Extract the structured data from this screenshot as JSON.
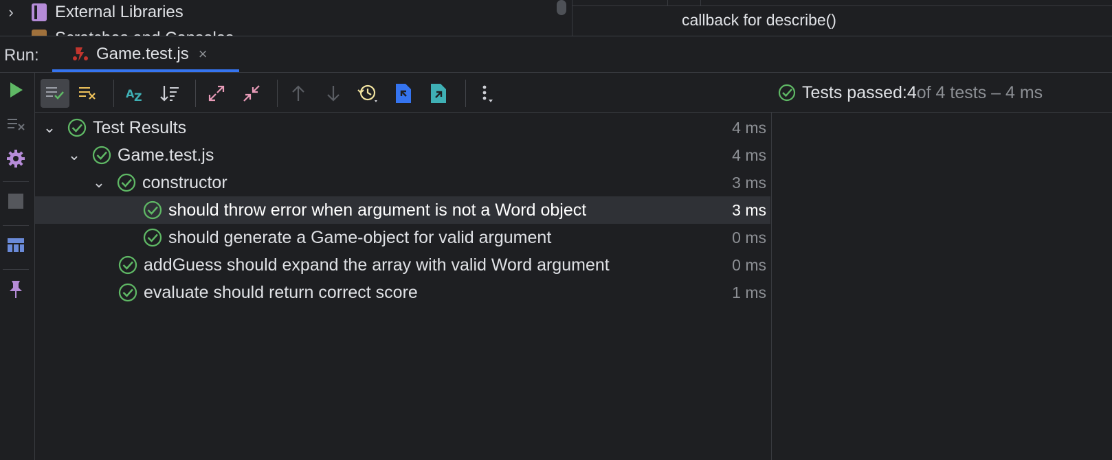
{
  "project_tree": {
    "items": [
      {
        "label": "External Libraries",
        "icon": "library-icon"
      },
      {
        "label": "Scratches and Consoles",
        "icon": "scratches-icon"
      }
    ]
  },
  "editor": {
    "breadcrumb": "callback for describe()"
  },
  "run_panel": {
    "label": "Run:",
    "tab": {
      "label": "Game.test.js",
      "icon": "jest-icon",
      "close": "×"
    }
  },
  "toolbar": {
    "buttons": [
      "show-passed-icon",
      "show-ignored-icon",
      "sort-alphabetically-icon",
      "sort-by-duration-icon",
      "expand-all-icon",
      "collapse-all-icon",
      "previous-failed-icon",
      "next-failed-icon",
      "test-history-icon",
      "import-tests-icon",
      "export-tests-icon",
      "more-options-icon"
    ],
    "status": {
      "prefix": "Tests passed: ",
      "passed": "4",
      "suffix": " of 4 tests – 4 ms"
    }
  },
  "left_strip": {
    "buttons": [
      "rerun-icon",
      "clear-icon",
      "settings-icon",
      "stop-icon",
      "layout-icon",
      "pin-icon"
    ]
  },
  "colors": {
    "pass_green": "#5fb865",
    "accent_blue": "#3574f0",
    "run_green": "#5fb865",
    "settings_purple": "#b68cd8"
  },
  "results": [
    {
      "label": "Test Results",
      "duration": "4 ms",
      "level": 0,
      "expandable": true,
      "selected": false
    },
    {
      "label": "Game.test.js",
      "duration": "4 ms",
      "level": 1,
      "expandable": true,
      "selected": false
    },
    {
      "label": "constructor",
      "duration": "3 ms",
      "level": 2,
      "expandable": true,
      "selected": false
    },
    {
      "label": "should throw error when argument is not a Word object",
      "duration": "3 ms",
      "level": 3,
      "expandable": false,
      "selected": true
    },
    {
      "label": "should generate a Game-object for valid argument",
      "duration": "0 ms",
      "level": 3,
      "expandable": false,
      "selected": false
    },
    {
      "label": "addGuess should expand the array with valid Word argument",
      "duration": "0 ms",
      "level": 2,
      "expandable": false,
      "selected": false
    },
    {
      "label": "evaluate should return correct score",
      "duration": "1 ms",
      "level": 2,
      "expandable": false,
      "selected": false
    }
  ]
}
